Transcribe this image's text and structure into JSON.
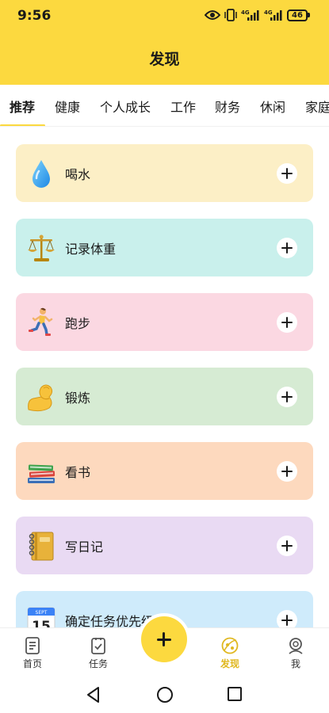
{
  "status": {
    "time": "9:56",
    "net1": "4G",
    "net2": "4G",
    "battery": "46"
  },
  "header": {
    "title": "发现"
  },
  "tabs": [
    {
      "label": "推荐",
      "active": true
    },
    {
      "label": "健康"
    },
    {
      "label": "个人成长"
    },
    {
      "label": "工作"
    },
    {
      "label": "财务"
    },
    {
      "label": "休闲"
    },
    {
      "label": "家庭"
    }
  ],
  "cards": [
    {
      "label": "喝水",
      "icon": "water-drop-icon",
      "bg": "#FCEFC6"
    },
    {
      "label": "记录体重",
      "icon": "scale-icon",
      "bg": "#C9F0EC"
    },
    {
      "label": "跑步",
      "icon": "runner-icon",
      "bg": "#FBD8E2"
    },
    {
      "label": "锻炼",
      "icon": "flexed-arm-icon",
      "bg": "#D6EBD3"
    },
    {
      "label": "看书",
      "icon": "books-icon",
      "bg": "#FDD9BE"
    },
    {
      "label": "写日记",
      "icon": "notebook-icon",
      "bg": "#E9DAF3"
    },
    {
      "label": "确定任务优先级",
      "icon": "calendar-icon",
      "bg": "#CFEBFB",
      "calendar_month": "SEPT",
      "calendar_day": "15"
    }
  ],
  "bottom_nav": [
    {
      "label": "首页",
      "icon": "document-icon"
    },
    {
      "label": "任务",
      "icon": "task-check-icon"
    },
    {
      "label": "发现",
      "icon": "discover-icon",
      "active": true
    },
    {
      "label": "我",
      "icon": "profile-icon"
    }
  ],
  "colors": {
    "accent": "#FCD93F",
    "active_nav": "#E0B820"
  }
}
